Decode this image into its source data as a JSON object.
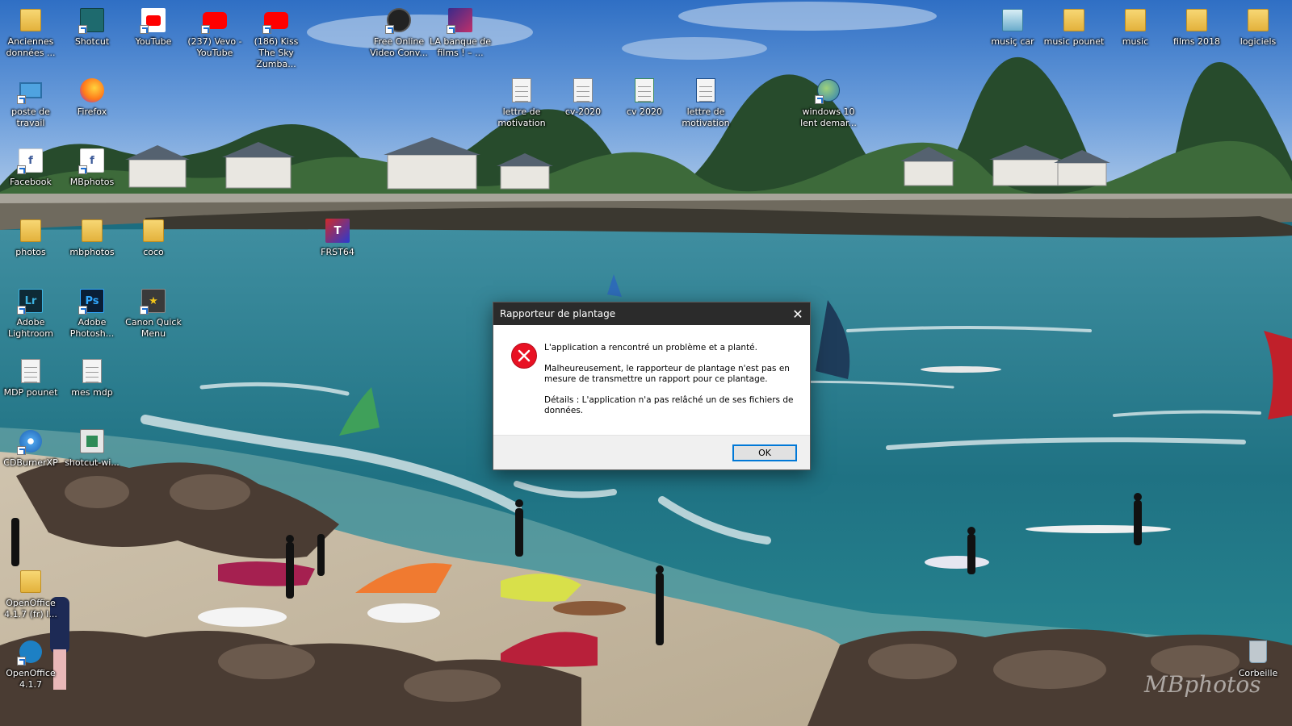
{
  "desktop": {
    "icons": [
      {
        "label": "Anciennes données ...",
        "kind": "folder-icon"
      },
      {
        "label": "Shotcut",
        "kind": "shotcut-icon"
      },
      {
        "label": "YouTube",
        "kind": "youtube-icon"
      },
      {
        "label": "(237) Vevo - YouTube",
        "kind": "youtube-icon"
      },
      {
        "label": "(186) Kiss The Sky Zumba...",
        "kind": "youtube-icon"
      },
      {
        "label": "Free Online Video Conv...",
        "kind": "video-converter-icon"
      },
      {
        "label": "LA banque de films ! – ...",
        "kind": "film-bank-icon"
      },
      {
        "label": "musiç car",
        "kind": "music-folder-icon"
      },
      {
        "label": "music pounet",
        "kind": "folder-icon"
      },
      {
        "label": "music",
        "kind": "folder-icon"
      },
      {
        "label": "films 2018",
        "kind": "folder-icon"
      },
      {
        "label": "logiciels",
        "kind": "folder-icon"
      },
      {
        "label": "poste de travail",
        "kind": "computer-icon"
      },
      {
        "label": "Firefox",
        "kind": "firefox-icon"
      },
      {
        "label": "lettre de motivation",
        "kind": "document-icon"
      },
      {
        "label": "cv-2020",
        "kind": "document-icon"
      },
      {
        "label": "cv 2020",
        "kind": "document-icon"
      },
      {
        "label": "lettre de motivation",
        "kind": "document-icon"
      },
      {
        "label": "windows 10 lent demar...",
        "kind": "web-link-icon"
      },
      {
        "label": "Facebook",
        "kind": "facebook-icon"
      },
      {
        "label": "MBphotos",
        "kind": "facebook-icon"
      },
      {
        "label": "photos",
        "kind": "folder-icon"
      },
      {
        "label": "mbphotos",
        "kind": "folder-icon"
      },
      {
        "label": "coco",
        "kind": "folder-icon"
      },
      {
        "label": "FRST64",
        "kind": "frst-icon"
      },
      {
        "label": "Adobe Lightroom",
        "kind": "lightroom-icon"
      },
      {
        "label": "Adobe Photosh...",
        "kind": "photoshop-icon"
      },
      {
        "label": "Canon Quick Menu",
        "kind": "canon-icon"
      },
      {
        "label": "MDP pounet",
        "kind": "text-file-icon"
      },
      {
        "label": "mes mdp",
        "kind": "text-file-icon"
      },
      {
        "label": "CDBurnerXP",
        "kind": "cdburner-icon"
      },
      {
        "label": "shotcut-wi...",
        "kind": "installer-icon"
      },
      {
        "label": "OpenOffice 4.1.7 (fr) I...",
        "kind": "folder-icon"
      },
      {
        "label": "OpenOffice 4.1.7",
        "kind": "openoffice-icon"
      },
      {
        "label": "Corbeille",
        "kind": "recycle-bin-icon"
      }
    ],
    "watermark": "MBphotos"
  },
  "dialog": {
    "title": "Rapporteur de plantage",
    "close_glyph": "✕",
    "message_main": "L'application a rencontré un problème et a planté.",
    "message_detail": "Malheureusement, le rapporteur de plantage n'est pas en mesure de transmettre un rapport pour ce plantage.",
    "message_details": "Détails : L'application n'a pas relâché un de ses fichiers de données.",
    "ok_label": "OK",
    "icon": "error-icon"
  }
}
